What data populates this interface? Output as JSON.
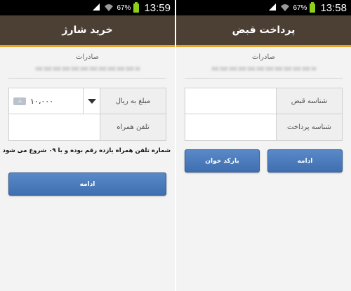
{
  "left_screen": {
    "status": {
      "battery_pct": "67%",
      "clock": "13:59"
    },
    "title": "خرید شارژ",
    "section_label": "صادرات",
    "form": {
      "amount_label": "مبلغ به ریال",
      "amount_value": "۱۰،۰۰۰",
      "phone_label": "تلفن همراه",
      "phone_value": ""
    },
    "hint": "شماره تلفن همراه یازده رقم بوده و با ۰۹ شروع می شود",
    "continue_button": "ادامه"
  },
  "right_screen": {
    "status": {
      "battery_pct": "67%",
      "clock": "13:58"
    },
    "title": "پرداخت قبض",
    "section_label": "صادرات",
    "form": {
      "bill_id_label": "شناسه قبض",
      "bill_id_value": "",
      "payment_id_label": "شناسه پرداخت",
      "payment_id_value": ""
    },
    "continue_button": "ادامه",
    "barcode_button": "بارکد خوان"
  },
  "colors": {
    "appbar": "#4c3f33",
    "appbar_accent": "#e6a229",
    "button": "#4a7bbd",
    "battery": "#8bd11b"
  }
}
